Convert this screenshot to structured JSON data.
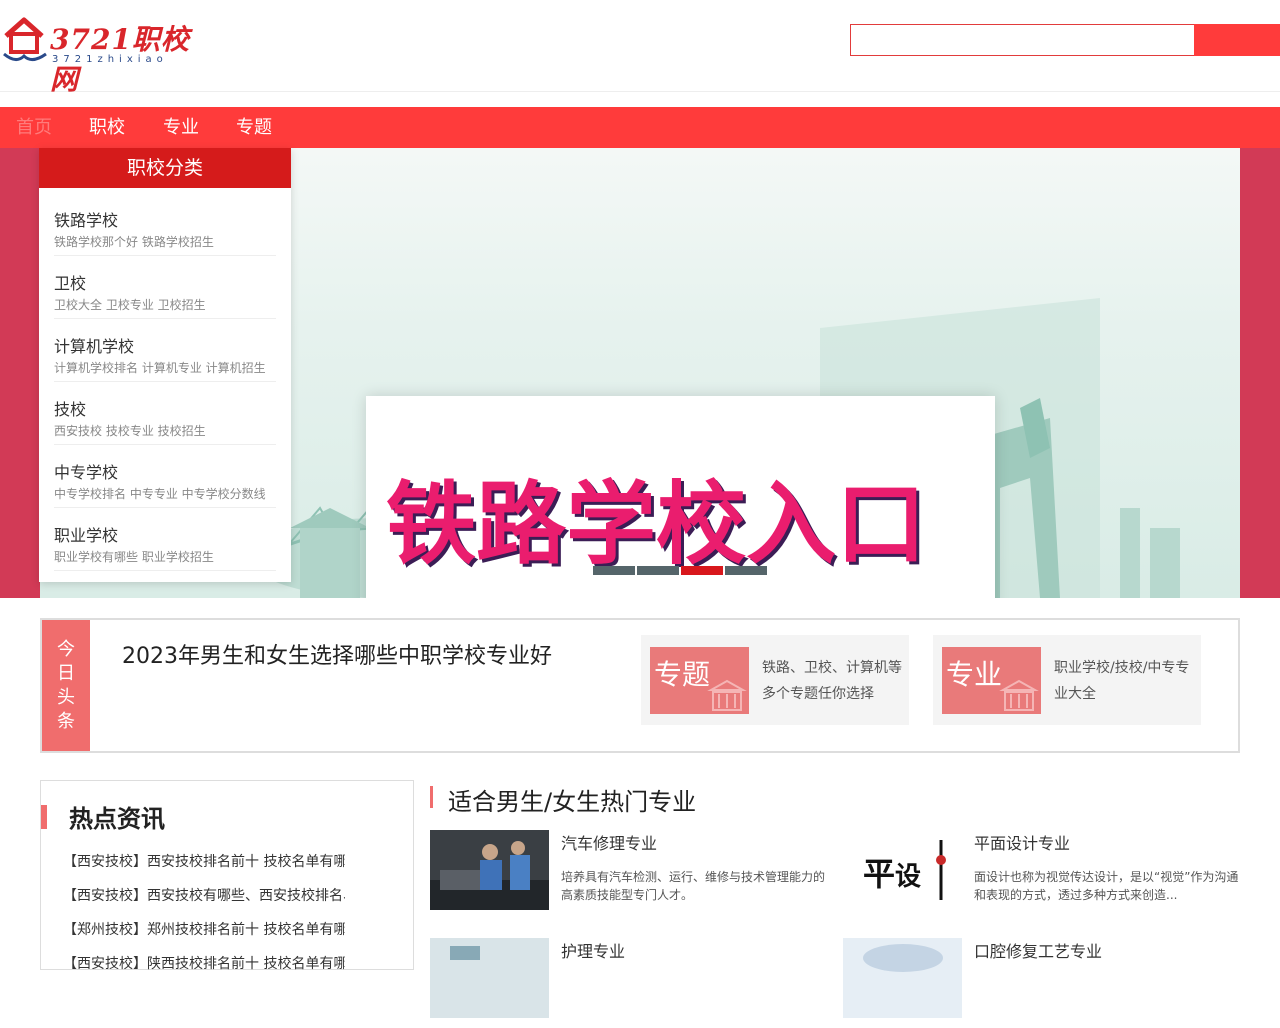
{
  "header": {
    "logo_text": "3721职校网",
    "logo_sub": "3721zhixiao",
    "search_placeholder": ""
  },
  "nav": [
    "首页",
    "职校",
    "专业",
    "专题"
  ],
  "category": {
    "title": "职校分类",
    "items": [
      {
        "name": "铁路学校",
        "sub": "铁路学校那个好 铁路学校招生"
      },
      {
        "name": "卫校",
        "sub": "卫校大全 卫校专业 卫校招生"
      },
      {
        "name": "计算机学校",
        "sub": "计算机学校排名 计算机专业 计算机招生"
      },
      {
        "name": "技校",
        "sub": "西安技校 技校专业 技校招生"
      },
      {
        "name": "中专学校",
        "sub": "中专学校排名 中专专业 中专学校分数线"
      },
      {
        "name": "职业学校",
        "sub": "职业学校有哪些 职业学校招生"
      }
    ]
  },
  "banner": {
    "title": "铁路学校入口",
    "slide_count": 4,
    "active_slide": 3
  },
  "headline": {
    "tag": "今日头条",
    "text": "2023年男生和女生选择哪些中职学校专业好",
    "promos": [
      {
        "label": "专题",
        "desc": "铁路、卫校、计算机等多个专题任你选择"
      },
      {
        "label": "专业",
        "desc": "职业学校/技校/中专专业大全"
      }
    ]
  },
  "hot": {
    "title": "热点资讯",
    "items": [
      "【西安技校】西安技校排名前十 技校名单有哪",
      "【西安技校】西安技校有哪些、西安技校排名、",
      "【郑州技校】郑州技校排名前十 技校名单有哪",
      "【西安技校】陕西技校排名前十 技校名单有哪"
    ]
  },
  "majors": {
    "title": "适合男生/女生热门专业",
    "items": [
      {
        "name": "汽车修理专业",
        "desc": "培养具有汽车检测、运行、维修与技术管理能力的高素质技能型专门人才。",
        "thumb": "auto-repair"
      },
      {
        "name": "平面设计专业",
        "desc": "面设计也称为视觉传达设计，是以“视觉”作为沟通和表现的方式，透过多种方式来创造...",
        "thumb": "graphic-design"
      },
      {
        "name": "护理专业",
        "desc": "",
        "thumb": "nursing"
      },
      {
        "name": "口腔修复工艺专业",
        "desc": "",
        "thumb": "dental"
      }
    ]
  },
  "colors": {
    "primary_red": "#ff3b3b",
    "dark_red": "#d51b1b",
    "banner_side": "#d23a56",
    "accent_pink": "#f06d6d"
  }
}
